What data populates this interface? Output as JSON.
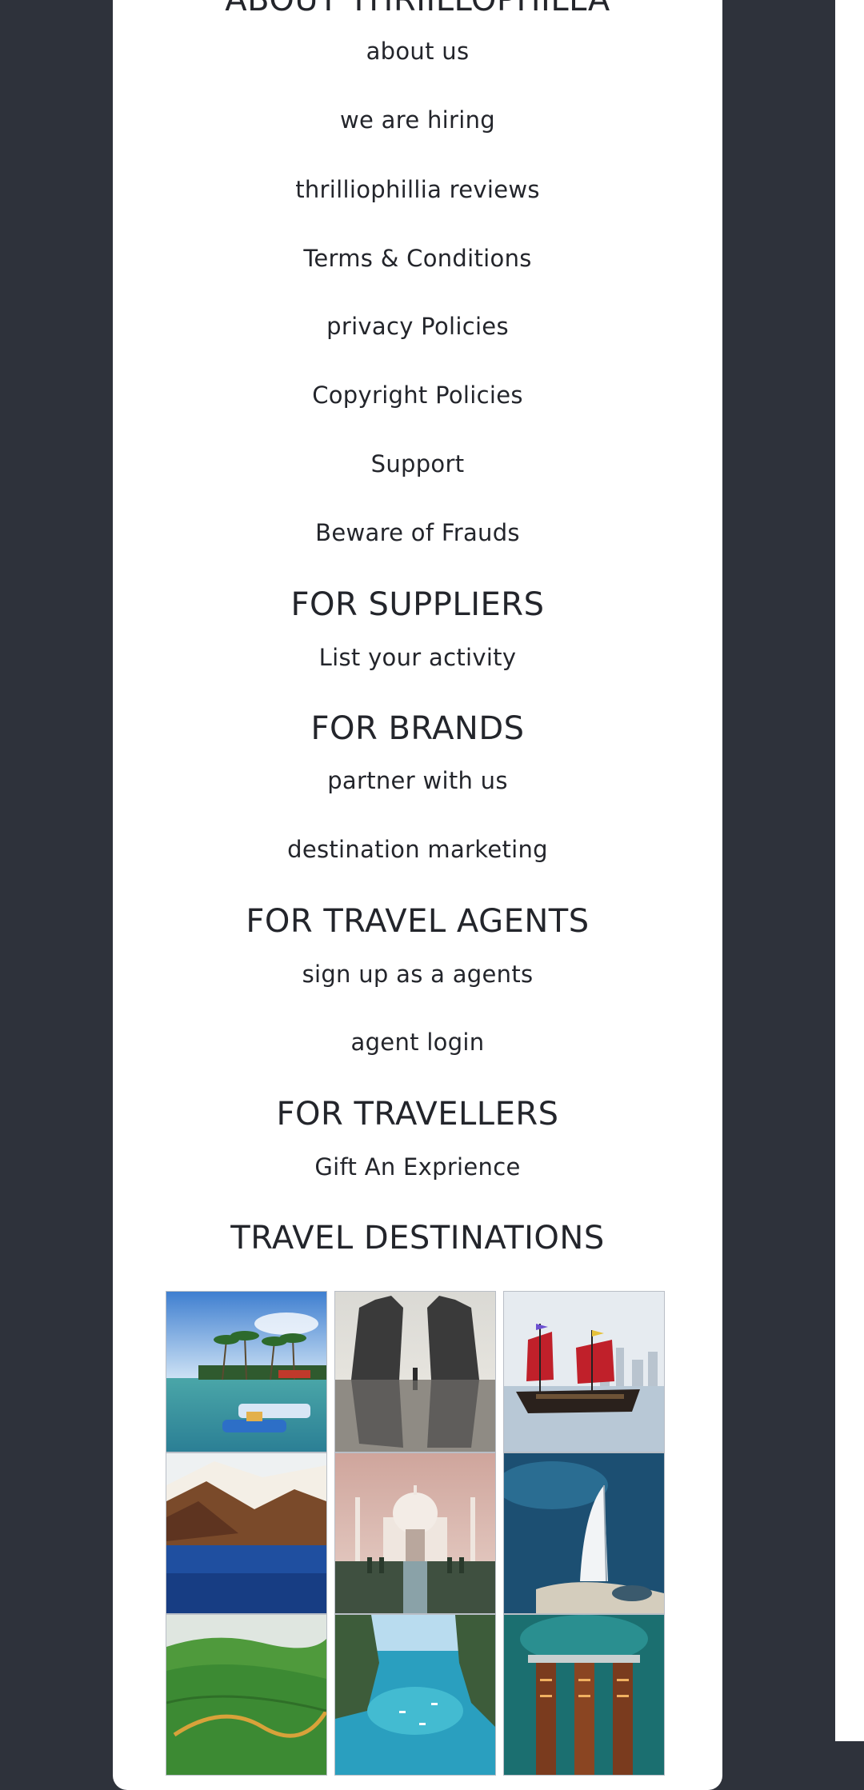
{
  "footer": {
    "about_heading": "ABOUT THRIILLOPHILLA",
    "about_links": [
      "about us",
      "we are hiring",
      "thrilliophillia reviews",
      "Terms & Conditions",
      "privacy Policies",
      "Copyright Policies",
      "Support",
      "Beware of Frauds"
    ],
    "suppliers_heading": "FOR SUPPLIERS",
    "suppliers_links": [
      "List your activity"
    ],
    "brands_heading": "FOR BRANDS",
    "brands_links": [
      "partner with us",
      "destination marketing"
    ],
    "agents_heading": "FOR TRAVEL AGENTS",
    "agents_links": [
      "sign up as a agents",
      "agent login"
    ],
    "travellers_heading": "FOR TRAVELLERS",
    "travellers_links": [
      "Gift An Exprience"
    ],
    "destinations_heading": "TRAVEL DESTINATIONS"
  },
  "colors": {
    "page_background": "#2e323b",
    "panel_background": "#ffffff",
    "text": "#23252b"
  }
}
